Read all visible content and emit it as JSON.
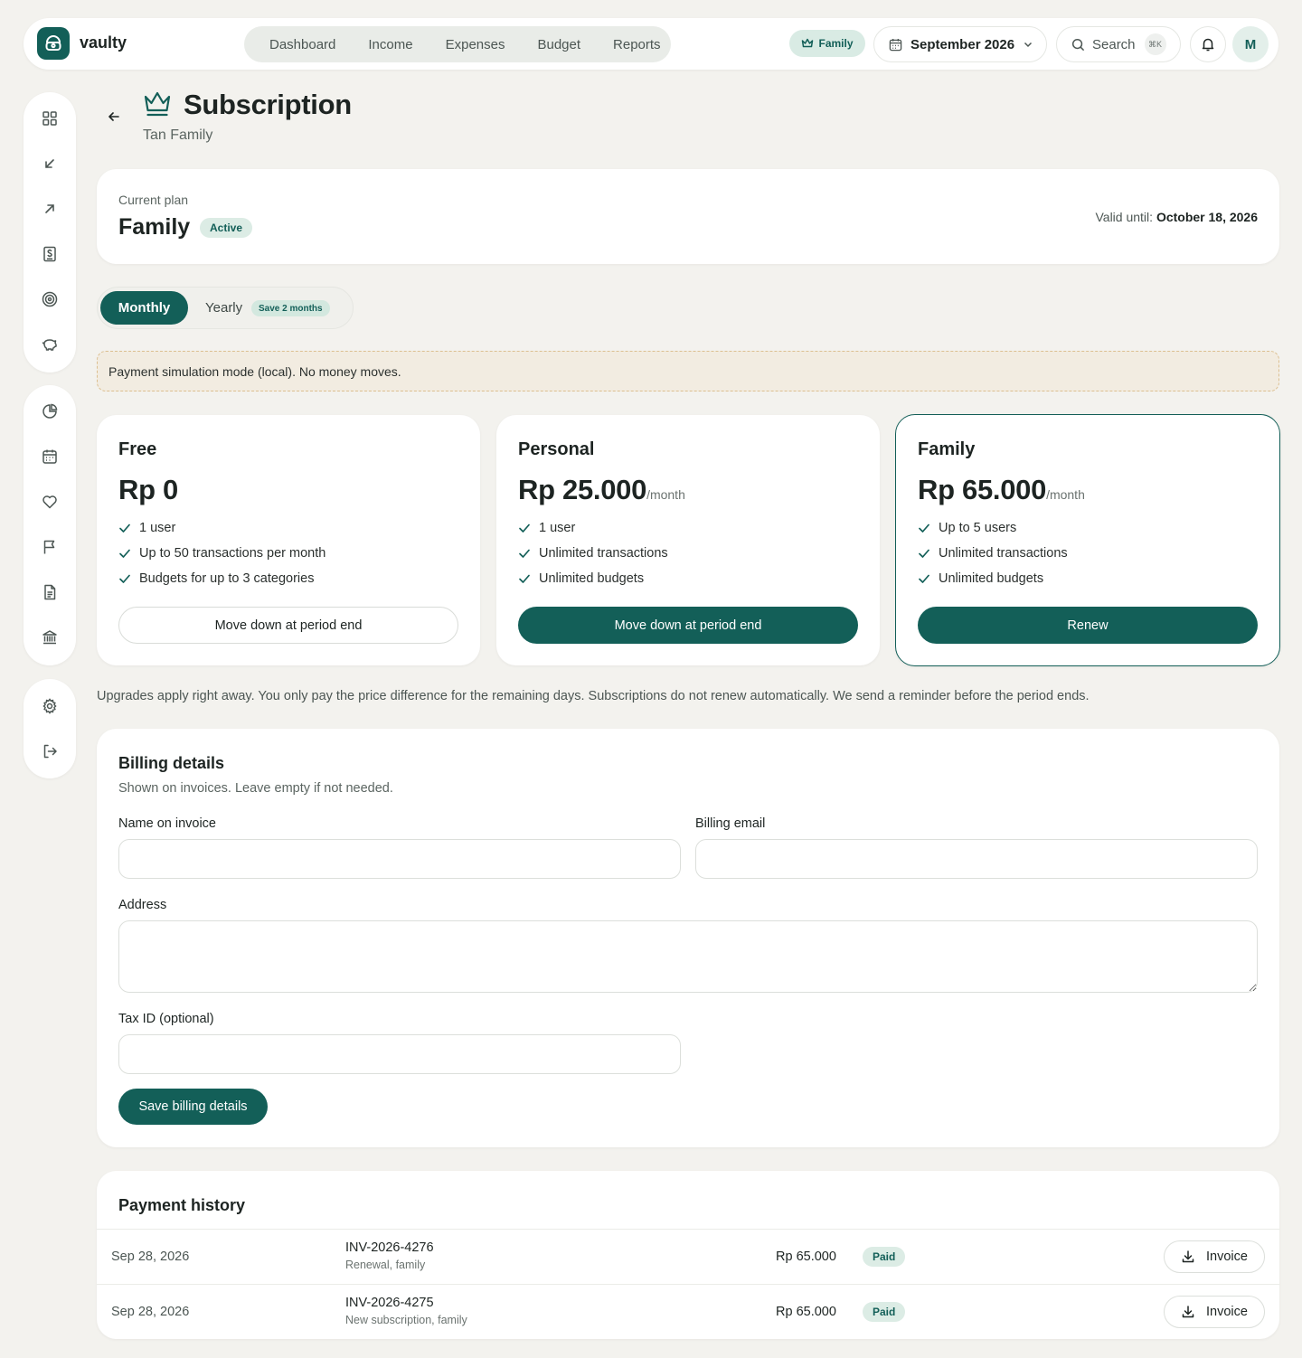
{
  "app": {
    "brand": "vaulty"
  },
  "topnav": {
    "tabs": [
      "Dashboard",
      "Income",
      "Expenses",
      "Budget",
      "Reports"
    ],
    "plan_chip": "Family",
    "month": "September 2026",
    "search_label": "Search",
    "search_shortcut": "⌘K",
    "avatar_initial": "M"
  },
  "sidebar": {
    "groups": [
      [
        "dashboard-icon",
        "income-icon",
        "expenses-icon",
        "budget-icon",
        "goals-icon",
        "savings-icon"
      ],
      [
        "reports-icon",
        "calendar-icon",
        "wishlist-icon",
        "flag-icon",
        "document-icon",
        "bank-icon"
      ],
      [
        "settings-icon",
        "logout-icon"
      ]
    ]
  },
  "page": {
    "title": "Subscription",
    "subtitle": "Tan Family"
  },
  "current_plan": {
    "label": "Current plan",
    "name": "Family",
    "status": "Active",
    "valid_label": "Valid until:",
    "valid_date": "October 18, 2026"
  },
  "billing_cycle": {
    "monthly": "Monthly",
    "yearly": "Yearly",
    "yearly_badge": "Save 2 months",
    "selected": "Monthly"
  },
  "notice": "Payment simulation mode (local). No money moves.",
  "plans": [
    {
      "name": "Free",
      "price": "Rp 0",
      "period": "",
      "features": [
        "1 user",
        "Up to 50 transactions per month",
        "Budgets for up to 3 categories"
      ],
      "action": "Move down at period end",
      "current": false
    },
    {
      "name": "Personal",
      "price": "Rp 25.000",
      "period": "/month",
      "features": [
        "1 user",
        "Unlimited transactions",
        "Unlimited budgets"
      ],
      "action": "Move down at period end",
      "current": false
    },
    {
      "name": "Family",
      "price": "Rp 65.000",
      "period": "/month",
      "features": [
        "Up to 5 users",
        "Unlimited transactions",
        "Unlimited budgets"
      ],
      "action": "Renew",
      "current": true
    }
  ],
  "footnote": "Upgrades apply right away. You only pay the price difference for the remaining days. Subscriptions do not renew automatically. We send a reminder before the period ends.",
  "billing": {
    "title": "Billing details",
    "subtitle": "Shown on invoices. Leave empty if not needed.",
    "name_label": "Name on invoice",
    "name_value": "",
    "email_label": "Billing email",
    "email_value": "",
    "address_label": "Address",
    "address_value": "",
    "taxid_label": "Tax ID (optional)",
    "taxid_value": "",
    "save_label": "Save billing details"
  },
  "payment_history": {
    "title": "Payment history",
    "rows": [
      {
        "date": "Sep 28, 2026",
        "invoice": "INV-2026-4276",
        "description": "Renewal, family",
        "amount": "Rp 65.000",
        "status": "Paid",
        "action": "Invoice"
      },
      {
        "date": "Sep 28, 2026",
        "invoice": "INV-2026-4275",
        "description": "New subscription, family",
        "amount": "Rp 65.000",
        "status": "Paid",
        "action": "Invoice"
      }
    ]
  },
  "colors": {
    "primary": "#135f58",
    "background": "#f3f2ee",
    "notice_bg": "#f2ece1",
    "notice_border": "#dcbf90",
    "badge_bg": "#dcece5"
  }
}
